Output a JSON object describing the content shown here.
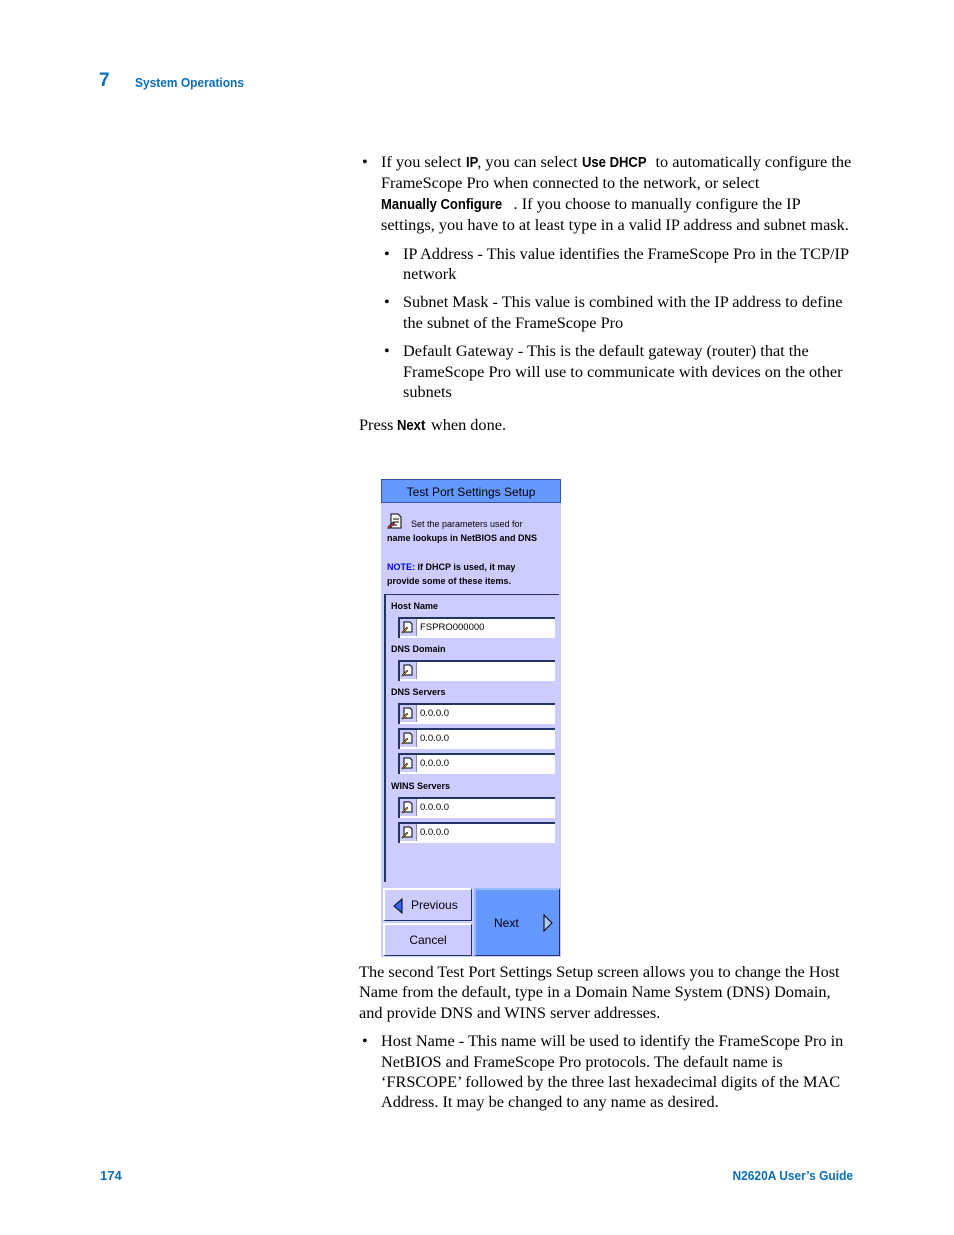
{
  "header": {
    "chapter_number": "7",
    "chapter_title": "System Operations"
  },
  "intro_bullet": {
    "p1": "If you select ",
    "b1": "IP",
    "p2": ", you can select ",
    "b2": "Use DHCP",
    "p3": " to automatically configure the FrameScope Pro when connected to the network, or select ",
    "b3": "Manually Configure",
    "p4": ". If you choose to manually configure the IP settings, you have to at least type in a valid IP address and subnet mask."
  },
  "sub_bullets": [
    "IP Address - This value identifies the FrameScope Pro in the TCP/IP network",
    "Subnet Mask - This value is combined with the IP address to define the subnet of the FrameScope Pro",
    "Default Gateway - This is the default gateway (router) that the FrameScope Pro will use to communicate with devices on the other subnets"
  ],
  "press_next": {
    "pre": "Press ",
    "bold": "Next",
    "post": " when done."
  },
  "screen": {
    "title": "Test Port Settings Setup",
    "intro_plain": "Set the parameters used for",
    "intro_bold": "name lookups in NetBIOS and DNS",
    "note_label": "NOTE:",
    "note_text": " If DHCP is used, it may",
    "note_text2": "provide some of these items.",
    "host_name_label": "Host Name",
    "host_name_value": "FSPRO000000",
    "dns_domain_label": "DNS Domain",
    "dns_domain_value": "",
    "dns_servers_label": "DNS Servers",
    "dns_servers": [
      "0.0.0.0",
      "0.0.0.0",
      "0.0.0.0"
    ],
    "wins_servers_label": "WINS Servers",
    "wins_servers": [
      "0.0.0.0",
      "0.0.0.0"
    ],
    "buttons": {
      "previous": "Previous",
      "cancel": "Cancel",
      "next": "Next"
    },
    "colors": {
      "title_bar": "#6699ff",
      "panel": "#ccccff",
      "next_button": "#6699ff"
    }
  },
  "after_para": "The second Test Port Settings Setup screen allows you to change the Host Name from the default, type in a Domain Name System (DNS) Domain, and provide DNS and WINS server addresses.",
  "host_bullet": "Host Name - This name will be used to identify the FrameScope Pro in NetBIOS and FrameScope Pro protocols. The default name is ‘FRSCOPE’ followed by the three last hexadecimal digits of the MAC Address. It may be changed to any name as desired.",
  "footer": {
    "page_number": "174",
    "guide_title": "N2620A User’s Guide"
  }
}
